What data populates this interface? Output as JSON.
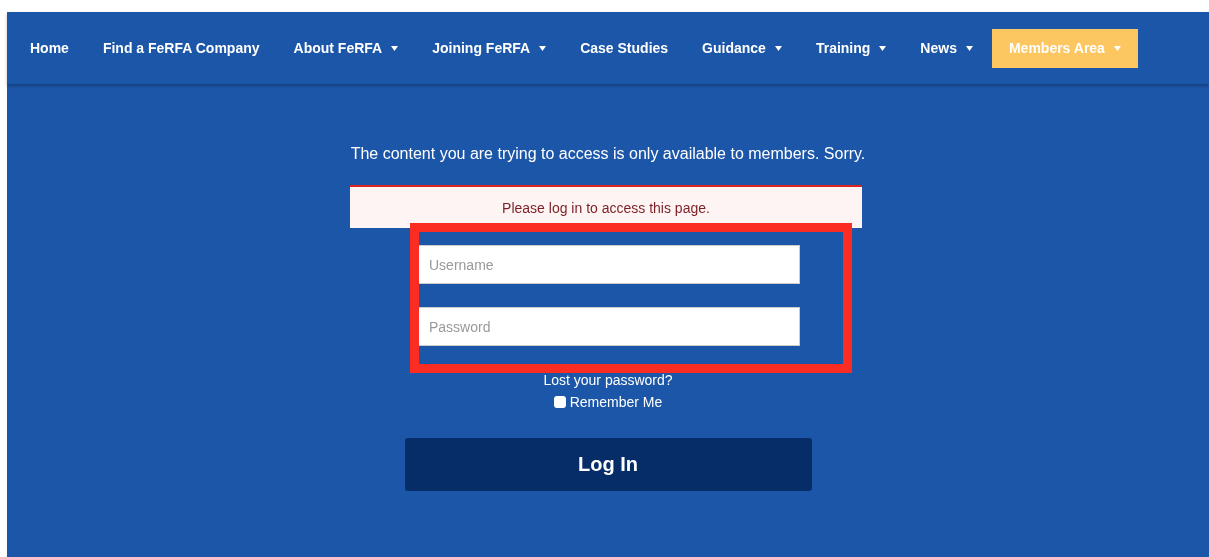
{
  "nav": [
    {
      "label": "Home",
      "has_menu": false,
      "selected": false
    },
    {
      "label": "Find a FeRFA Company",
      "has_menu": false,
      "selected": false
    },
    {
      "label": "About FeRFA",
      "has_menu": true,
      "selected": false
    },
    {
      "label": "Joining FeRFA",
      "has_menu": true,
      "selected": false
    },
    {
      "label": "Case Studies",
      "has_menu": false,
      "selected": false
    },
    {
      "label": "Guidance",
      "has_menu": true,
      "selected": false
    },
    {
      "label": "Training",
      "has_menu": true,
      "selected": false
    },
    {
      "label": "News",
      "has_menu": true,
      "selected": false
    },
    {
      "label": "Members Area",
      "has_menu": true,
      "selected": true
    }
  ],
  "notice": "The content you are trying to access is only available to members. Sorry.",
  "alert": "Please log in to access this page.",
  "login": {
    "username": {
      "placeholder": "Username"
    },
    "password": {
      "placeholder": "Password"
    },
    "lost_password": "Lost your password?",
    "remember": {
      "label": "Remember Me",
      "checked": false
    },
    "submit": "Log In"
  }
}
